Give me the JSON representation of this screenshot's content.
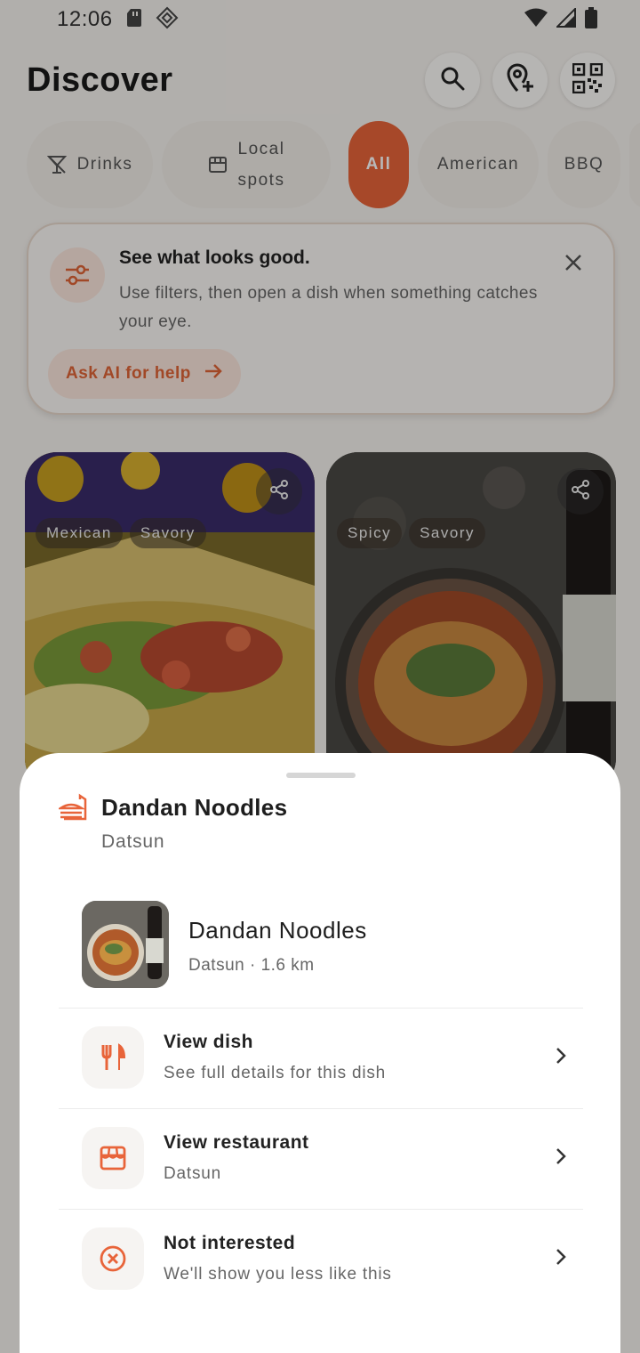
{
  "status_bar": {
    "time": "12:06"
  },
  "header": {
    "title": "Discover"
  },
  "chips": [
    {
      "label": "Drinks",
      "icon": "cocktail-icon"
    },
    {
      "label": "Local\nspots",
      "icon": "storefront-icon"
    },
    {
      "label": "All",
      "active": true
    },
    {
      "label": "American"
    },
    {
      "label": "BBQ"
    }
  ],
  "tip": {
    "title": "See what looks good.",
    "body": "Use filters, then open a dish when something catches your eye.",
    "ask_ai": "Ask AI for help"
  },
  "cards": [
    {
      "tags": [
        "Mexican",
        "Savory"
      ]
    },
    {
      "tags": [
        "Spicy",
        "Savory"
      ]
    }
  ],
  "sheet": {
    "title": "Dandan Noodles",
    "subtitle": "Datsun",
    "dish": {
      "name": "Dandan Noodles",
      "meta": "Datsun · 1.6 km"
    },
    "actions": [
      {
        "title": "View dish",
        "subtitle": "See full details for this dish",
        "icon": "utensils-icon"
      },
      {
        "title": "View restaurant",
        "subtitle": "Datsun",
        "icon": "storefront-icon"
      },
      {
        "title": "Not interested",
        "subtitle": "We'll show you less like this",
        "icon": "circle-x-icon"
      }
    ]
  },
  "colors": {
    "accent": "#e8643a",
    "background": "#f6f3ef"
  }
}
